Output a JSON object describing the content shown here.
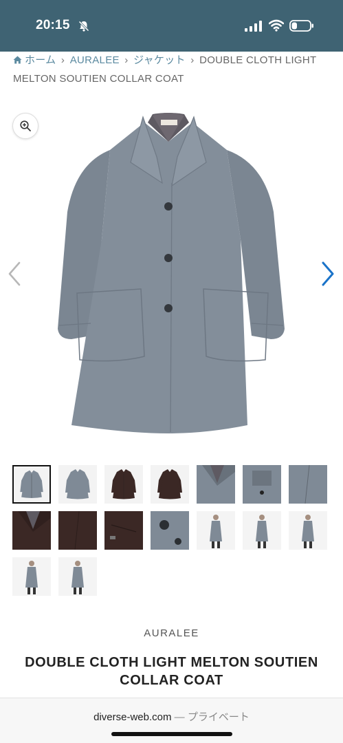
{
  "status_bar": {
    "time": "20:15",
    "bell_state": "silenced",
    "signal_bars": 4,
    "battery_level": 0.3
  },
  "breadcrumb": {
    "items": [
      {
        "label": "ホーム"
      },
      {
        "label": "AURALEE"
      },
      {
        "label": "ジャケット"
      },
      {
        "label": "DOUBLE CLOTH LIGHT MELTON SOUTIEN COLLAR COAT"
      }
    ],
    "separator": "›"
  },
  "colors": {
    "status_bar_bg": "#3f6373",
    "link": "#5b8aa0",
    "arrow_active": "#1a73c9",
    "coat_gray": "#7f8a96",
    "coat_brown": "#3b2825"
  },
  "gallery": {
    "icons": {
      "zoom": "zoom-in-icon",
      "prev": "chevron-left-icon",
      "next": "chevron-right-icon"
    },
    "thumbnails": [
      {
        "variant": "gray-front",
        "active": true
      },
      {
        "variant": "gray-back",
        "active": false
      },
      {
        "variant": "brown-front",
        "active": false
      },
      {
        "variant": "brown-back",
        "active": false
      },
      {
        "variant": "gray-collar-detail",
        "active": false
      },
      {
        "variant": "gray-collar-up",
        "active": false
      },
      {
        "variant": "gray-fabric",
        "active": false
      },
      {
        "variant": "brown-collar-detail",
        "active": false
      },
      {
        "variant": "brown-fabric",
        "active": false
      },
      {
        "variant": "brown-pocket",
        "active": false
      },
      {
        "variant": "gray-button",
        "active": false
      },
      {
        "variant": "model-gray-1",
        "active": false
      },
      {
        "variant": "model-gray-2",
        "active": false
      },
      {
        "variant": "model-gray-3",
        "active": false
      },
      {
        "variant": "model-gray-4",
        "active": false
      },
      {
        "variant": "model-gray-5",
        "active": false
      }
    ]
  },
  "product": {
    "brand": "AURALEE",
    "title": "DOUBLE CLOTH LIGHT MELTON SOUTIEN COLLAR COAT"
  },
  "browser": {
    "domain": "diverse-web.com",
    "separator": "—",
    "mode": "プライベート"
  }
}
